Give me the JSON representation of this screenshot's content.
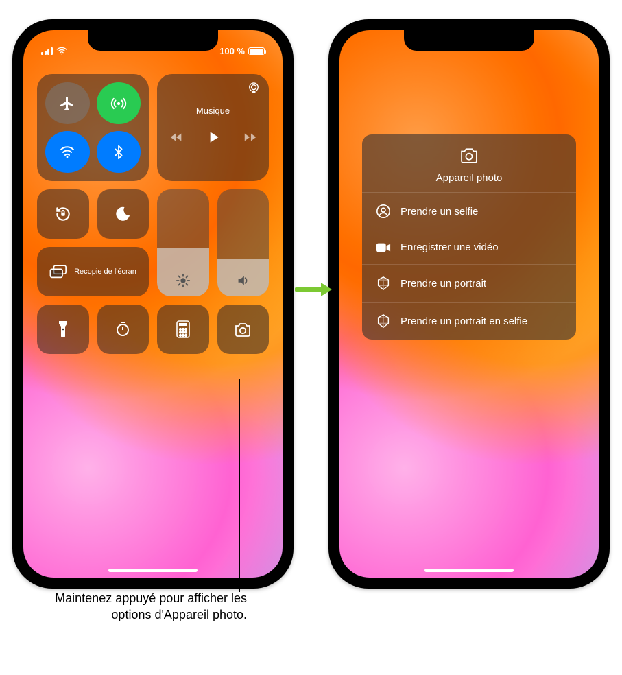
{
  "status": {
    "battery_text": "100 %"
  },
  "cc": {
    "music_label": "Musique",
    "mirror_label": "Recopie de l'écran",
    "toggles": {
      "airplane": false,
      "cellular": true,
      "wifi": true,
      "bluetooth": true
    },
    "sliders": {
      "brightness_pct": 45,
      "volume_pct": 35
    }
  },
  "popup": {
    "title": "Appareil photo",
    "items": [
      {
        "icon": "selfie",
        "label": "Prendre un selfie"
      },
      {
        "icon": "video",
        "label": "Enregistrer une vidéo"
      },
      {
        "icon": "portrait",
        "label": "Prendre un portrait"
      },
      {
        "icon": "portrait",
        "label": "Prendre un portrait en selfie"
      }
    ]
  },
  "callout": {
    "text": "Maintenez appuyé pour afficher les options d'Appareil photo."
  }
}
